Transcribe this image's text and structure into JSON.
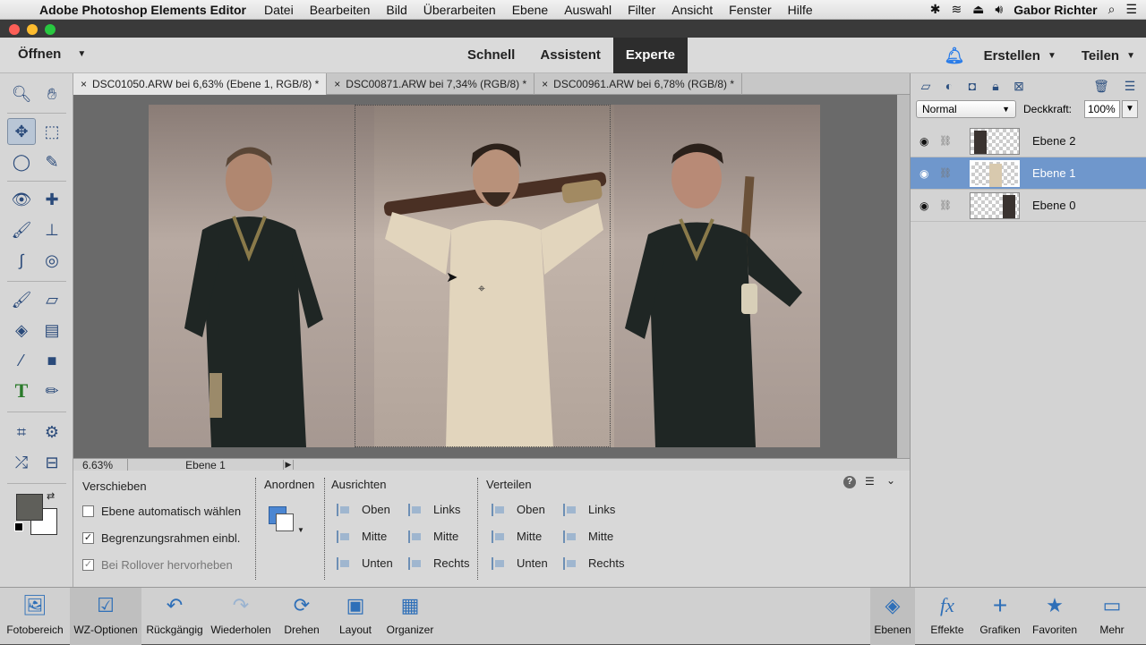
{
  "menubar": {
    "app_name": "Adobe Photoshop Elements Editor",
    "menus": [
      "Datei",
      "Bearbeiten",
      "Bild",
      "Überarbeiten",
      "Ebene",
      "Auswahl",
      "Filter",
      "Ansicht",
      "Fenster",
      "Hilfe"
    ],
    "user": "Gabor Richter"
  },
  "topbar": {
    "open_label": "Öffnen",
    "modes": [
      "Schnell",
      "Assistent",
      "Experte"
    ],
    "active_mode": "Experte",
    "create_label": "Erstellen",
    "share_label": "Teilen"
  },
  "tabs": [
    {
      "label": "DSC01050.ARW bei 6,63% (Ebene 1, RGB/8) *",
      "active": true
    },
    {
      "label": "DSC00871.ARW bei 7,34% (RGB/8) *",
      "active": false
    },
    {
      "label": "DSC00961.ARW bei 6,78% (RGB/8) *",
      "active": false
    }
  ],
  "status": {
    "zoom": "6.63%",
    "layer": "Ebene 1"
  },
  "options": {
    "tool_name": "Verschieben",
    "checkboxes": [
      {
        "label": "Ebene automatisch wählen",
        "checked": false
      },
      {
        "label": "Begrenzungsrahmen einbl.",
        "checked": true
      },
      {
        "label": "Bei Rollover hervorheben",
        "checked": true
      }
    ],
    "arrange_title": "Anordnen",
    "align_title": "Ausrichten",
    "align": [
      "Oben",
      "Mitte",
      "Unten",
      "Links",
      "Mitte",
      "Rechts"
    ],
    "distribute_title": "Verteilen",
    "distribute": [
      "Oben",
      "Mitte",
      "Unten",
      "Links",
      "Mitte",
      "Rechts"
    ]
  },
  "layers_panel": {
    "blend_mode": "Normal",
    "opacity_label": "Deckkraft:",
    "opacity": "100%",
    "layers": [
      {
        "name": "Ebene 2",
        "selected": false
      },
      {
        "name": "Ebene 1",
        "selected": true
      },
      {
        "name": "Ebene 0",
        "selected": false
      }
    ]
  },
  "bottombar": {
    "left": [
      "Fotobereich",
      "WZ-Optionen",
      "Rückgängig",
      "Wiederholen",
      "Drehen",
      "Layout",
      "Organizer"
    ],
    "right": [
      "Ebenen",
      "Effekte",
      "Grafiken",
      "Favoriten",
      "Mehr"
    ]
  },
  "colors": {
    "accent": "#2d2d2d",
    "selection": "#6f97cc",
    "foreground_swatch": "#5f5f5a",
    "background_swatch": "#ffffff"
  }
}
